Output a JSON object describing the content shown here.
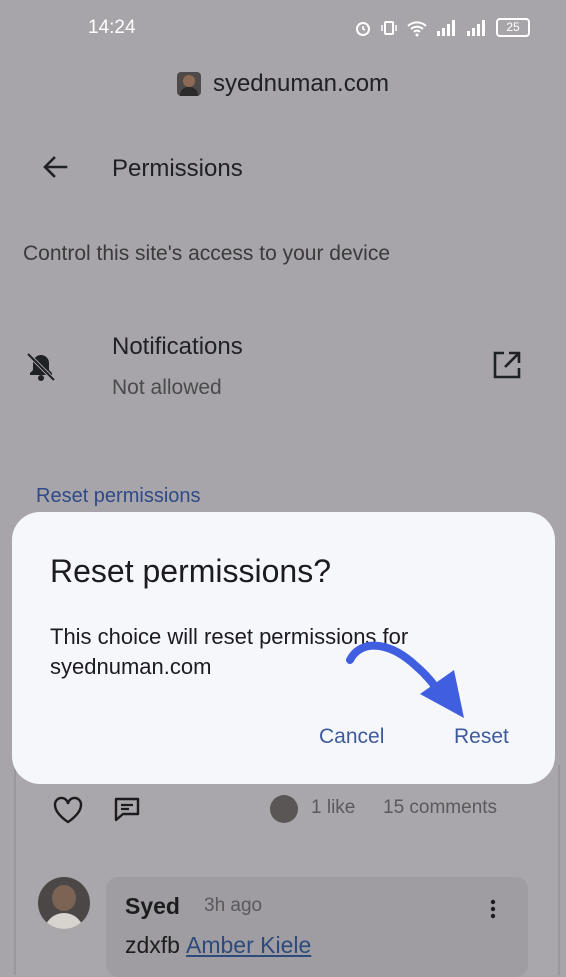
{
  "status_bar": {
    "time": "14:24",
    "battery": "25"
  },
  "site": {
    "domain": "syednuman.com"
  },
  "header": {
    "title": "Permissions"
  },
  "description": "Control this site's access to your device",
  "notifications": {
    "title": "Notifications",
    "status": "Not allowed"
  },
  "reset_link": "Reset permissions",
  "feed": {
    "likes": "1 like",
    "comments": "15 comments",
    "comment": {
      "author": "Syed",
      "time": "3h ago",
      "text": "zdxfb",
      "mention": "Amber Kiele"
    }
  },
  "dialog": {
    "title": "Reset permissions?",
    "body": "This choice will reset permissions for syednuman.com",
    "cancel_label": "Cancel",
    "reset_label": "Reset"
  },
  "colors": {
    "accent": "#3d5a9a",
    "annotation_arrow": "#3f5fe0",
    "scrim": "#a7a5aa"
  }
}
